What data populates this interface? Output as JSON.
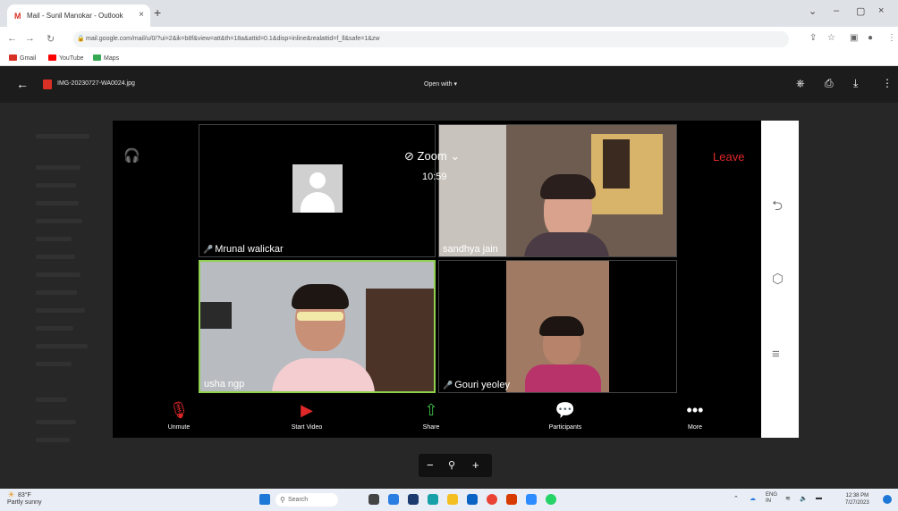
{
  "browser": {
    "tab_title": "Mail - Sunil Manokar - Outlook",
    "new_tab_icon": "plus",
    "url": "mail.google.com/mail/u/0/?ui=2&ik=b8f&view=att&th=18a&attid=0.1&disp=inline&realattid=f_ll&safe=1&zw",
    "bookmarks": [
      {
        "label": "Gmail",
        "color": "#d93025"
      },
      {
        "label": "YouTube",
        "color": "#ff0000"
      },
      {
        "label": "Maps",
        "color": "#34a853"
      }
    ]
  },
  "viewer": {
    "filename": "IMG-20230727-WA0024.jpg",
    "open_with": "Open with",
    "open_with_icon": "caret-down"
  },
  "zoom": {
    "title": "Zoom",
    "time": "10:59",
    "leave": "Leave",
    "participants": [
      {
        "name": "Mrunal walickar",
        "muted": true,
        "video": false
      },
      {
        "name": "sandhya jain",
        "muted": false,
        "video": true
      },
      {
        "name": "usha ngp",
        "muted": false,
        "video": true,
        "active_speaker": true
      },
      {
        "name": "Gouri yeoley",
        "muted": true,
        "video": true
      }
    ],
    "controls": [
      {
        "label": "Unmute",
        "icon": "mic-muted-icon",
        "color": "#e02828"
      },
      {
        "label": "Start Video",
        "icon": "video-off-icon",
        "color": "#e02828"
      },
      {
        "label": "Share",
        "icon": "share-icon",
        "color": "#3fbd4a"
      },
      {
        "label": "Participants",
        "icon": "chat-bubble-icon",
        "color": "#ffffff"
      },
      {
        "label": "More",
        "icon": "more-icon",
        "color": "#ffffff"
      }
    ]
  },
  "taskbar": {
    "weather_temp": "83°F",
    "weather_text": "Partly sunny",
    "search_placeholder": "Search",
    "language": "ENG\nIN",
    "clock_time": "12:38 PM",
    "clock_date": "7/27/2023"
  }
}
